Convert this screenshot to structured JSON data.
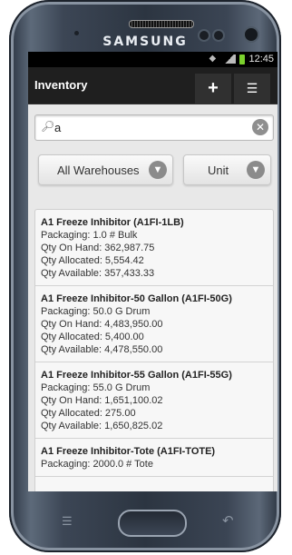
{
  "device": {
    "brand": "SAMSUNG"
  },
  "status": {
    "time": "12:45"
  },
  "appbar": {
    "title": "Inventory",
    "add_label": "+",
    "menu_label": "☰"
  },
  "search": {
    "value": "a"
  },
  "filters": {
    "warehouse": "All Warehouses",
    "unit": "Unit"
  },
  "items": [
    {
      "name": "A1 Freeze Inhibitor (A1FI-1LB)",
      "packaging": "Packaging: 1.0 # Bulk",
      "on_hand": "Qty On Hand: 362,987.75",
      "allocated": "Qty Allocated: 5,554.42",
      "available": "Qty Available: 357,433.33"
    },
    {
      "name": "A1 Freeze Inhibitor-50 Gallon (A1FI-50G)",
      "packaging": "Packaging: 50.0 G Drum",
      "on_hand": "Qty On Hand: 4,483,950.00",
      "allocated": "Qty Allocated: 5,400.00",
      "available": "Qty Available: 4,478,550.00"
    },
    {
      "name": "A1 Freeze Inhibitor-55 Gallon (A1FI-55G)",
      "packaging": "Packaging: 55.0 G Drum",
      "on_hand": "Qty On Hand: 1,651,100.02",
      "allocated": "Qty Allocated: 275.00",
      "available": "Qty Available: 1,650,825.02"
    },
    {
      "name": "A1 Freeze Inhibitor-Tote (A1FI-TOTE)",
      "packaging": "Packaging: 2000.0 # Tote",
      "on_hand": "",
      "allocated": "",
      "available": ""
    }
  ]
}
